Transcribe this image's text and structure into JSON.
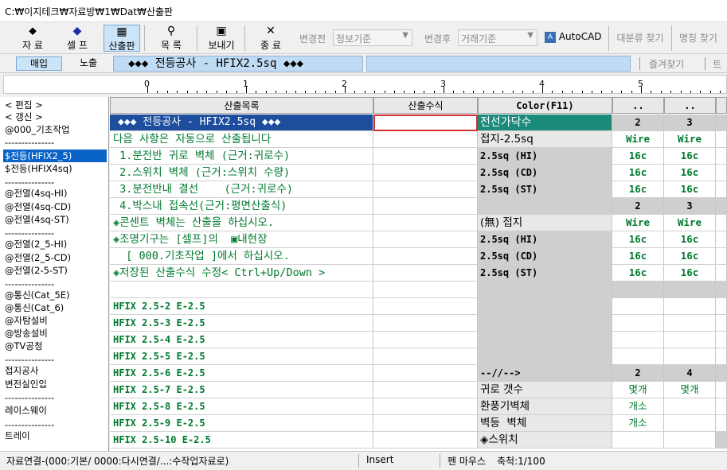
{
  "title": "C:₩이지테크₩자료방₩1₩Dat₩산출판",
  "toolbar": {
    "data": "자 료",
    "self": "셀 프",
    "calc": "산출판",
    "index": "목 록",
    "send": "보내기",
    "exit": "종 료",
    "before_label": "변경전",
    "before_value": "정보기준",
    "after_label": "변경후",
    "after_value": "거래기준",
    "autocad": "AutoCAD",
    "category_search": "대분류 찾기",
    "name_search": "명칭 찾기"
  },
  "tabs": {
    "buy": "매입",
    "expose": "노출",
    "title": "◆◆◆ 전등공사 - HFIX2.5sq ◆◆◆",
    "fav": "즐겨찾기",
    "fav_icon": "트"
  },
  "ruler": [
    "0",
    "1",
    "2",
    "3",
    "4",
    "5"
  ],
  "left_list": [
    "< 편집 >",
    "< 갱신 >",
    "@000_기초작업",
    "---------------",
    "$전등(HFIX2_5)",
    "$전등(HFIX4sq)",
    "---------------",
    "@전열(4sq-HI)",
    "@전열(4sq-CD)",
    "@전열(4sq-ST)",
    "---------------",
    "@전열(2_5-HI)",
    "@전열(2_5-CD)",
    "@전열(2-5-ST)",
    "---------------",
    "@통신(Cat_5E)",
    "@통신(Cat_6)",
    "@자탐설비",
    "@방송설비",
    "@TV공청",
    "---------------",
    "접지공사",
    "변전실인입",
    "---------------",
    "레이스웨이",
    "---------------",
    "트레이"
  ],
  "headers": {
    "list": "산출목록",
    "formula": "산출수식",
    "color": "Color(F11)",
    "c4": "..",
    "c5": ".."
  },
  "rows": [
    {
      "name": "◆◆◆ 전등공사 - HFIX2.5sq ◆◆◆",
      "color": "전선가닥수",
      "v1": "2",
      "v2": "3"
    },
    {
      "name": "다음 사항은 자동으로 산출됩니다",
      "color": "접지-2.5sq",
      "v1": "Wire",
      "v2": "Wire"
    },
    {
      "name": " 1.분전반 귀로 벽체 (근거:귀로수)",
      "color": "2.5sq (HI)",
      "v1": "16c",
      "v2": "16c"
    },
    {
      "name": " 2.스위치 벽체 (근거:스위치 수량)",
      "color": "2.5sq (CD)",
      "v1": "16c",
      "v2": "16c"
    },
    {
      "name": " 3.분전반내 결선    (근거:귀로수)",
      "color": "2.5sq (ST)",
      "v1": "16c",
      "v2": "16c"
    },
    {
      "name": " 4.박스내 접속선(근거:평면산출식)",
      "color": "",
      "v1": "2",
      "v2": "3"
    },
    {
      "name": "◈콘센트 벽체는 산출을 하십시오.",
      "color": "(無) 접지",
      "v1": "Wire",
      "v2": "Wire"
    },
    {
      "name": "◈조명기구는 [셀프]의  ▣내현장",
      "color": "2.5sq (HI)",
      "v1": "16c",
      "v2": "16c"
    },
    {
      "name": "  [ 000.기초작업 ]에서 하십시오.",
      "color": "2.5sq (CD)",
      "v1": "16c",
      "v2": "16c"
    },
    {
      "name": "◈저장된 산출수식 수정< Ctrl+Up/Down >",
      "color": "2.5sq (ST)",
      "v1": "16c",
      "v2": "16c"
    },
    {
      "name": "",
      "color": "",
      "v1": "",
      "v2": ""
    },
    {
      "name": "HFIX 2.5-2 E-2.5",
      "color": "",
      "v1": "",
      "v2": ""
    },
    {
      "name": "HFIX 2.5-3 E-2.5",
      "color": "",
      "v1": "",
      "v2": ""
    },
    {
      "name": "HFIX 2.5-4 E-2.5",
      "color": "",
      "v1": "",
      "v2": ""
    },
    {
      "name": "HFIX 2.5-5 E-2.5",
      "color": "",
      "v1": "",
      "v2": ""
    },
    {
      "name": "HFIX 2.5-6 E-2.5",
      "color": "--//-->",
      "v1": "2",
      "v2": "4"
    },
    {
      "name": "HFIX 2.5-7 E-2.5",
      "color": "귀로 갯수",
      "v1": "몇개",
      "v2": "몇개"
    },
    {
      "name": "HFIX 2.5-8 E-2.5",
      "color": "환풍기벽체",
      "v1": "개소",
      "v2": ""
    },
    {
      "name": "HFIX 2.5-9 E-2.5",
      "color": "벽등  벽체",
      "v1": "개소",
      "v2": ""
    },
    {
      "name": "HFIX 2.5-10 E-2.5",
      "color": "◈스위치",
      "v1": "",
      "v2": ""
    }
  ],
  "status": {
    "link": "자료연결-(000:기본/ 0000:다시연결/...:수작업자료로)",
    "mode": "Insert",
    "pen": "펜 마우스",
    "scale": "축척:1/100"
  },
  "colors": {
    "accent": "#0a64c8",
    "teal": "#1a8a7a",
    "green": "#007a2e",
    "banner": "#1d4e9e"
  }
}
